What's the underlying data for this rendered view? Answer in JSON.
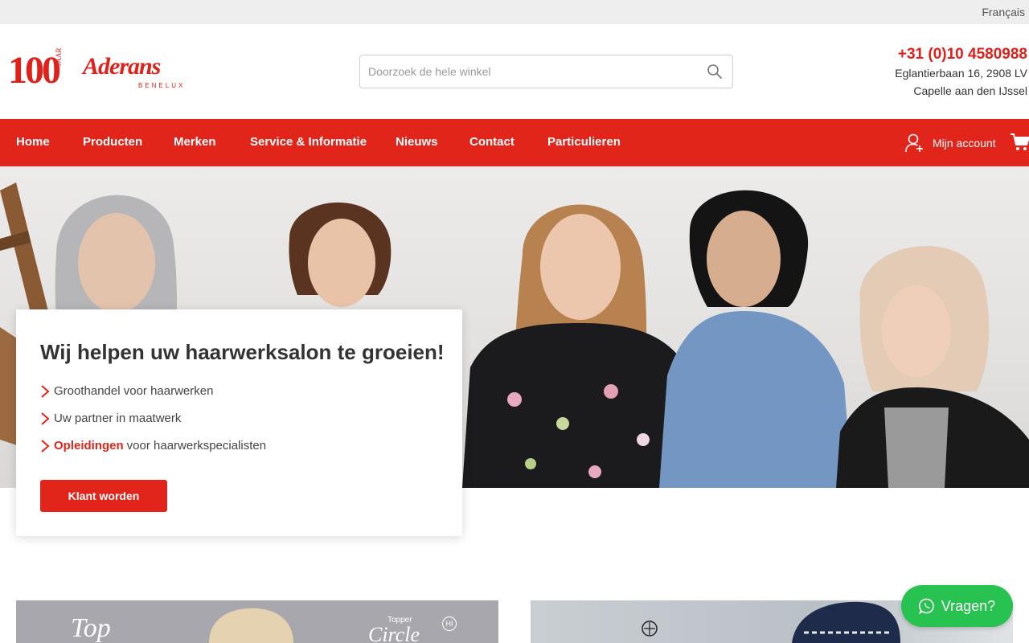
{
  "topbar": {
    "language_link": "Français"
  },
  "header": {
    "logo": {
      "anniversary_number": "100",
      "anniversary_word": "JAAR",
      "brand": "Aderans",
      "region": "BENELUX"
    },
    "search": {
      "placeholder": "Doorzoek de hele winkel",
      "value": ""
    },
    "contact": {
      "phone": "+31 (0)10 4580988",
      "address_line1": "Eglantierbaan 16, 2908 LV",
      "address_line2": "Capelle aan den IJssel"
    }
  },
  "nav": {
    "items": [
      {
        "label": "Home"
      },
      {
        "label": "Producten"
      },
      {
        "label": "Merken"
      },
      {
        "label": "Service & Informatie"
      },
      {
        "label": "Nieuws"
      },
      {
        "label": "Contact"
      },
      {
        "label": "Particulieren"
      }
    ],
    "account_label": "Mijn account"
  },
  "hero": {
    "title": "Wij helpen uw haarwerksalon te groeien!",
    "benefits": [
      {
        "link": "",
        "text": "Groothandel voor haarwerken"
      },
      {
        "link": "",
        "text": "Uw partner in maatwerk"
      },
      {
        "link": "Opleidingen",
        "text": "voor haarwerkspecialisten"
      }
    ],
    "cta_label": "Klant worden"
  },
  "promos": {
    "left": {
      "brand_text": "Top",
      "product_label_small": "Topper",
      "product_label_script": "Circle",
      "badge": "HI"
    }
  },
  "chat": {
    "label": "Vragen?"
  },
  "icons": {
    "search": "search-icon",
    "account": "user-plus-icon",
    "cart": "cart-icon",
    "chevron": "chevron-right-icon",
    "whatsapp": "whatsapp-icon"
  },
  "colors": {
    "brand_red": "#e1251b",
    "chat_green": "#28c250",
    "topbar_gray": "#eeeeee"
  }
}
